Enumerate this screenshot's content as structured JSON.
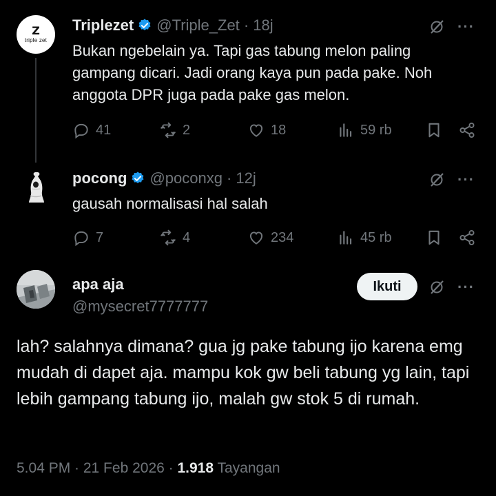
{
  "tweets": [
    {
      "name": "Triplezet",
      "handle": "@Triple_Zet",
      "time": "· 18j",
      "avatar_logo_text": "triple zet",
      "text": "Bukan ngebelain ya. Tapi gas tabung melon paling gampang dicari. Jadi orang kaya pun pada pake. Noh anggota DPR juga pada pake gas melon.",
      "replies": "41",
      "reposts": "2",
      "likes": "18",
      "views": "59 rb"
    },
    {
      "name": "pocong",
      "handle": "@poconxg",
      "time": "· 12j",
      "text": "gausah normalisasi hal salah",
      "replies": "7",
      "reposts": "4",
      "likes": "234",
      "views": "45 rb"
    }
  ],
  "main": {
    "name": "apa aja",
    "handle": "@mysecret7777777",
    "follow_label": "Ikuti",
    "text": "lah? salahnya dimana? gua jg pake tabung ijo karena emg mudah di dapet aja. mampu kok gw beli tabung yg lain, tapi lebih gampang tabung ijo, malah gw stok 5 di rumah.",
    "time": "5.04 PM · 21 Feb 2026 · ",
    "views": "1.918",
    "views_label": "Tayangan"
  },
  "colors": {
    "background": "#000000",
    "text": "#e7e9ea",
    "muted": "#71767b",
    "verified": "#1d9bf0",
    "follow_bg": "#eff3f4"
  },
  "icons": [
    "verified-badge-icon",
    "grok-icon",
    "more-icon",
    "reply-icon",
    "repost-icon",
    "like-icon",
    "views-icon",
    "bookmark-icon",
    "share-icon"
  ]
}
